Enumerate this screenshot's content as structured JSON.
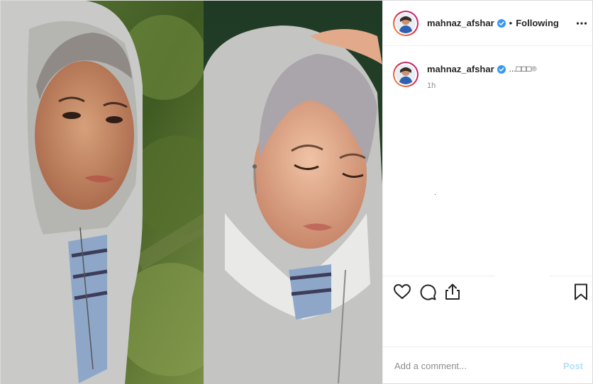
{
  "post": {
    "username": "mahnaz_afshar",
    "follow_separator": "•",
    "follow_status": "Following",
    "caption": "...□□□⌾",
    "timestamp": "1h"
  },
  "comment": {
    "placeholder": "Add a comment...",
    "post_label": "Post"
  },
  "colors": {
    "verified": "#3897f0",
    "post_button_disabled": "#b2dffc",
    "text_primary": "#262626",
    "text_secondary": "#8e8e8e",
    "hoodie_gray": "#c8c8c6",
    "foliage_green": "#4b6a2c"
  },
  "icons": {
    "more": "more-options-icon",
    "verified": "verified-badge-icon",
    "like": "heart-icon",
    "comment": "comment-icon",
    "share": "share-icon",
    "save": "bookmark-icon"
  }
}
